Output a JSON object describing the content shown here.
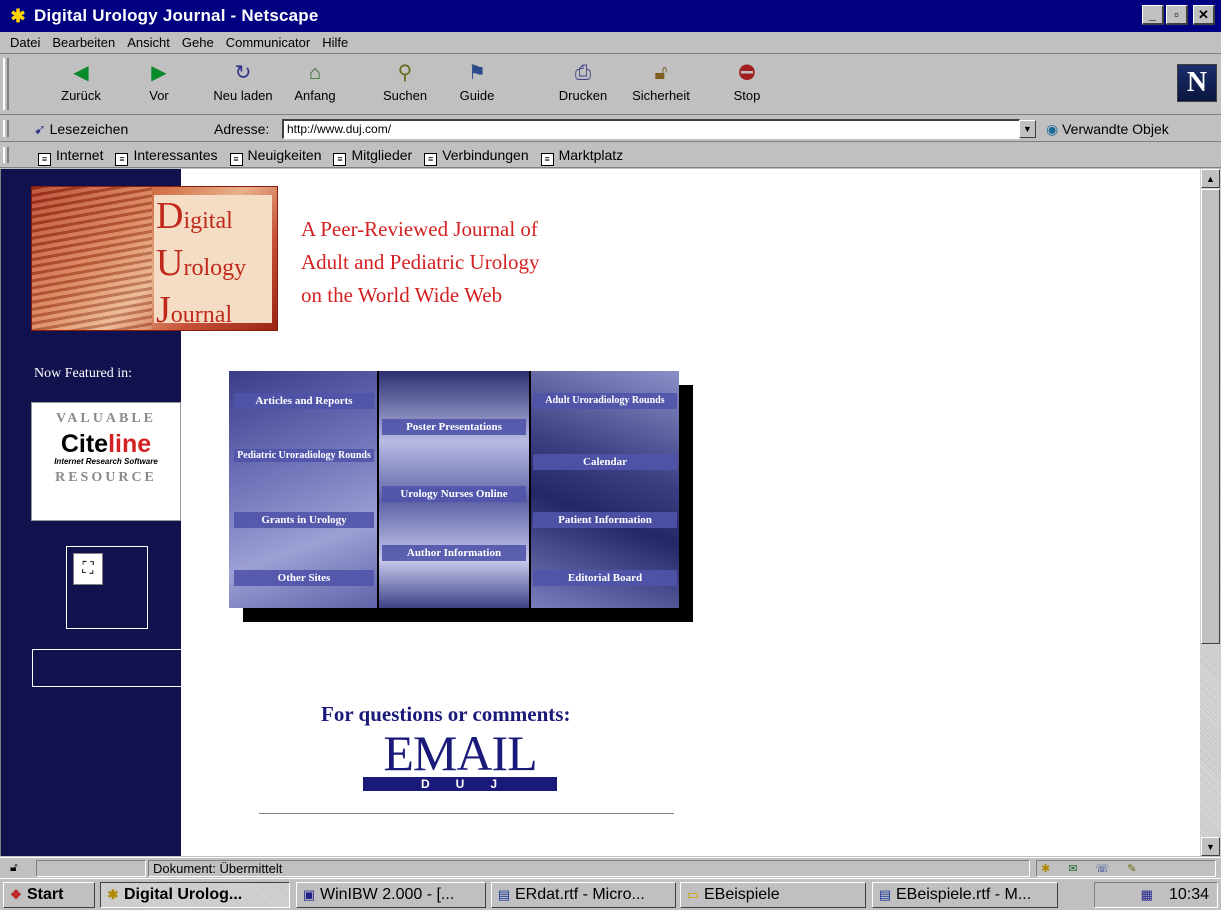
{
  "window": {
    "title": "Digital Urology Journal - Netscape"
  },
  "menu": [
    "Datei",
    "Bearbeiten",
    "Ansicht",
    "Gehe",
    "Communicator",
    "Hilfe"
  ],
  "toolbar": {
    "buttons": [
      {
        "label": "Zurück",
        "icon": "back-arrow-icon"
      },
      {
        "label": "Vor",
        "icon": "forward-arrow-icon"
      },
      {
        "label": "Neu laden",
        "icon": "reload-icon"
      },
      {
        "label": "Anfang",
        "icon": "home-icon"
      },
      {
        "label": "Suchen",
        "icon": "search-icon"
      },
      {
        "label": "Guide",
        "icon": "guide-icon"
      },
      {
        "label": "Drucken",
        "icon": "print-icon"
      },
      {
        "label": "Sicherheit",
        "icon": "security-lock-icon"
      },
      {
        "label": "Stop",
        "icon": "stop-icon"
      }
    ]
  },
  "location": {
    "bookmarks_label": "Lesezeichen",
    "address_label": "Adresse:",
    "url": "http://www.duj.com/",
    "related_label": "Verwandte Objek"
  },
  "personal_toolbar": [
    "Internet",
    "Interessantes",
    "Neuigkeiten",
    "Mitglieder",
    "Verbindungen",
    "Marktplatz"
  ],
  "page": {
    "logo": {
      "line1": "igital",
      "line2": "rology",
      "line3": "ournal",
      "cap1": "D",
      "cap2": "U",
      "cap3": "J"
    },
    "tagline": [
      "A Peer-Reviewed Journal of",
      "Adult and Pediatric Urology",
      "on the World Wide Web"
    ],
    "featured_label": "Now Featured in:",
    "citeline": {
      "top": "VALUABLE",
      "brand_a": "Cite",
      "brand_b": "line",
      "sub": "Internet Research Software",
      "bottom": "RESOURCE"
    },
    "image_map": {
      "col1": [
        "Articles and Reports",
        "Pediatric Uroradiology Rounds",
        "Grants in Urology",
        "Other Sites"
      ],
      "col2": [
        "Poster Presentations",
        "Urology Nurses Online",
        "Author Information"
      ],
      "col3": [
        "Adult Uroradiology Rounds",
        "Calendar",
        "Patient Information",
        "Editorial Board"
      ]
    },
    "questions": "For questions or comments:",
    "email_big": "EMAIL",
    "email_sub": "DUJ"
  },
  "status": {
    "message": "Dokument: Übermittelt"
  },
  "taskbar": {
    "start": "Start",
    "tasks": [
      {
        "label": "Digital Urolog...",
        "active": true
      },
      {
        "label": "WinIBW 2.000 - [...",
        "active": false
      },
      {
        "label": "ERdat.rtf - Micro...",
        "active": false
      },
      {
        "label": "EBeispiele",
        "active": false
      },
      {
        "label": "EBeispiele.rtf - M...",
        "active": false
      }
    ],
    "clock": "10:34"
  },
  "colors": {
    "titlebar": "#000080",
    "sidebar": "#11114d",
    "accent_red": "#d42121",
    "navy_text": "#1a1a7a"
  }
}
